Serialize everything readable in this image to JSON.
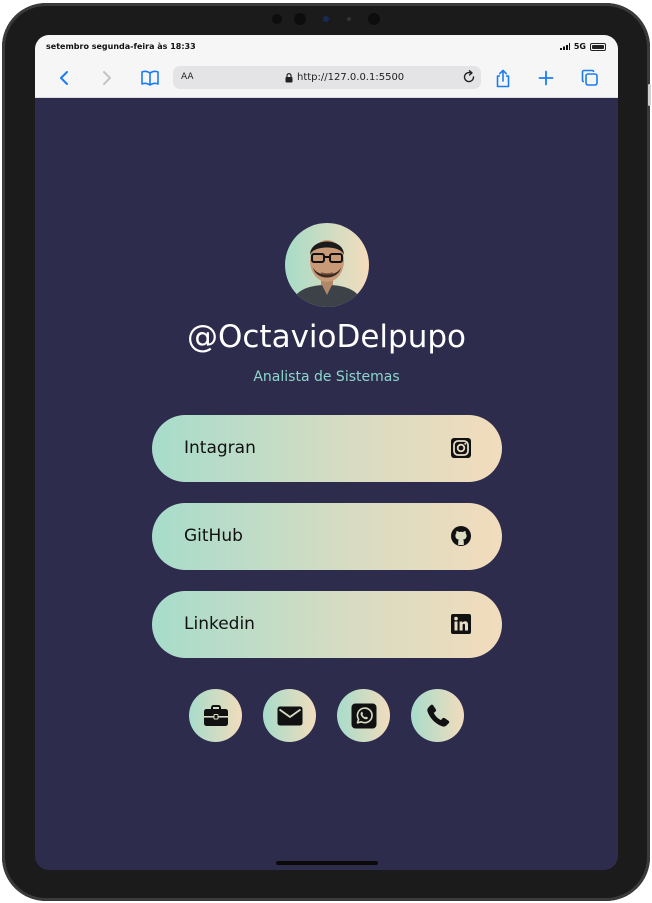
{
  "status_bar": {
    "time": "setembro segunda-feira às 18:33",
    "network": "5G"
  },
  "browser": {
    "text_size_label": "AA",
    "url": "http://127.0.0.1:5500",
    "icons": [
      "back-icon",
      "forward-icon",
      "bookmarks-icon",
      "lock-icon",
      "reload-icon",
      "share-icon",
      "add-tab-icon",
      "tabs-icon"
    ]
  },
  "profile": {
    "username": "@OctavioDelpupo",
    "role": "Analista de Sistemas"
  },
  "links": [
    {
      "label": "Intagran",
      "icon": "instagram-icon"
    },
    {
      "label": "GitHub",
      "icon": "github-icon"
    },
    {
      "label": "Linkedin",
      "icon": "linkedin-icon"
    }
  ],
  "contact_icons": [
    "briefcase-icon",
    "mail-icon",
    "whatsapp-icon",
    "phone-icon"
  ],
  "colors": {
    "background": "#2e2c4d",
    "gradient_start": "#a7dccb",
    "gradient_end": "#f2dcbc",
    "role_text": "#8dd6cc",
    "browser_accent": "#1a7cf5"
  }
}
